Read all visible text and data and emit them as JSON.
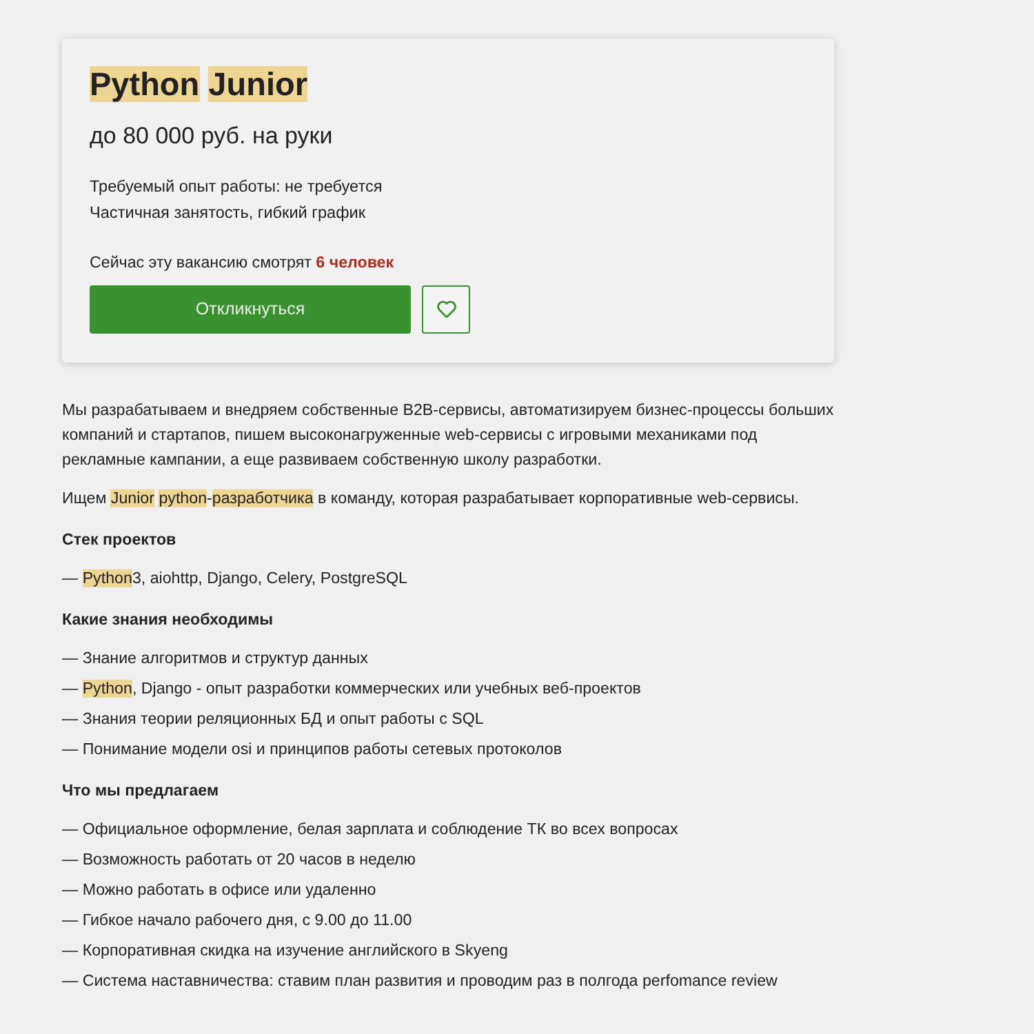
{
  "vacancy": {
    "title": [
      {
        "text": "Python",
        "highlighted": true,
        "gap_after": true
      },
      {
        "text": "Junior",
        "highlighted": true
      }
    ],
    "salary": "до 80 000 руб. на руки",
    "details": [
      "Требуемый опыт работы: не требуется",
      "Частичная занятость, гибкий график"
    ],
    "viewers": {
      "text": "Сейчас эту вакансию смотрят",
      "count": "6 человек"
    },
    "apply_button": "Откликнуться"
  },
  "description": [
    {
      "kind": "paragraph",
      "segments": [
        {
          "text": "Мы разрабатываем и внедряем собственные B2B-сервисы, автоматизируем бизнес-процессы больших компаний и стартапов, пишем высоконагруженные web-сервисы с игровыми механиками под рекламные кампании, а еще развиваем собственную школу разработки.",
          "highlighted": false
        }
      ]
    },
    {
      "kind": "paragraph",
      "segments": [
        {
          "text": "Ищем ",
          "highlighted": false
        },
        {
          "text": "Junior",
          "highlighted": true,
          "gap_after": true
        },
        {
          "text": "python",
          "highlighted": true
        },
        {
          "text": "-",
          "highlighted": false
        },
        {
          "text": "разработчика",
          "highlighted": true
        },
        {
          "text": " в команду, которая разрабатывает корпоративные web-сервисы.",
          "highlighted": false
        }
      ]
    },
    {
      "kind": "heading",
      "segments": [
        {
          "text": "Стек проектов",
          "highlighted": false
        }
      ]
    },
    {
      "kind": "bullet",
      "segments": [
        {
          "text": "— ",
          "highlighted": false
        },
        {
          "text": "Python",
          "highlighted": true
        },
        {
          "text": "3, aiohttp, Django, Celery, PostgreSQL",
          "highlighted": false
        }
      ]
    },
    {
      "kind": "heading",
      "segments": [
        {
          "text": "Какие знания необходимы",
          "highlighted": false
        }
      ]
    },
    {
      "kind": "bullet",
      "segments": [
        {
          "text": "— Знание алгоритмов и структур данных",
          "highlighted": false
        }
      ]
    },
    {
      "kind": "bullet",
      "segments": [
        {
          "text": "— ",
          "highlighted": false
        },
        {
          "text": "Python",
          "highlighted": true
        },
        {
          "text": ", Django - опыт разработки коммерческих или учебных веб-проектов",
          "highlighted": false
        }
      ]
    },
    {
      "kind": "bullet",
      "segments": [
        {
          "text": "— Знания теории реляционных БД и опыт работы с SQL",
          "highlighted": false
        }
      ]
    },
    {
      "kind": "bullet",
      "segments": [
        {
          "text": "— Понимание модели osi и принципов работы сетевых протоколов",
          "highlighted": false
        }
      ]
    },
    {
      "kind": "heading",
      "segments": [
        {
          "text": "Что мы предлагаем",
          "highlighted": false
        }
      ]
    },
    {
      "kind": "bullet",
      "segments": [
        {
          "text": "— Официальное оформление, белая зарплата и соблюдение ТК во всех вопросах",
          "highlighted": false
        }
      ]
    },
    {
      "kind": "bullet",
      "segments": [
        {
          "text": "— Возможность работать от 20 часов в неделю",
          "highlighted": false
        }
      ]
    },
    {
      "kind": "bullet",
      "segments": [
        {
          "text": "— Можно работать в офисе или удаленно",
          "highlighted": false
        }
      ]
    },
    {
      "kind": "bullet",
      "segments": [
        {
          "text": "— Гибкое начало рабочего дня, с 9.00 до 11.00",
          "highlighted": false
        }
      ]
    },
    {
      "kind": "bullet",
      "segments": [
        {
          "text": "— Корпоративная скидка на изучение английского в Skyeng",
          "highlighted": false
        }
      ]
    },
    {
      "kind": "bullet",
      "segments": [
        {
          "text": "— Система наставничества: ставим план развития и проводим раз в полгода perfomance review",
          "highlighted": false
        }
      ]
    }
  ]
}
